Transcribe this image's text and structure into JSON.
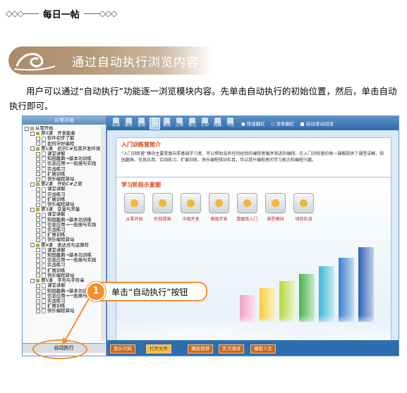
{
  "header": {
    "tip_title": "每日一帖",
    "decor_left": "◇◇◇——",
    "decor_right": "——◇◇◇"
  },
  "section": {
    "title": "通过自动执行浏览内容"
  },
  "paragraph": "用户可以通过“自动执行”功能逐一浏览模块内容。先单击自动执行的初始位置，然后，单击自动执行即可。",
  "screenshot": {
    "panel_title": "从零开始",
    "tree": [
      {
        "level": 0,
        "kind": "root",
        "text": "从零开始"
      },
      {
        "level": 1,
        "kind": "book",
        "text": "第0课　开发能泰"
      },
      {
        "level": 2,
        "kind": "page",
        "text": "软件初步了解"
      },
      {
        "level": 2,
        "kind": "page",
        "text": "如何学好编程"
      },
      {
        "level": 1,
        "kind": "book",
        "text": "第1课　初识C#及其开发环境"
      },
      {
        "level": 2,
        "kind": "page",
        "text": "课堂讲解"
      },
      {
        "level": 2,
        "kind": "page",
        "text": "知园趣典→基本功训练"
      },
      {
        "level": 2,
        "kind": "page",
        "text": "信息应用→一拓展与实践"
      },
      {
        "level": 2,
        "kind": "page",
        "text": "实战练习"
      },
      {
        "level": 2,
        "kind": "page",
        "text": "扩展训练"
      },
      {
        "level": 2,
        "kind": "page",
        "text": "快乐编程驿站"
      },
      {
        "level": 1,
        "kind": "book",
        "text": "第2课　开始C#之旅"
      },
      {
        "level": 2,
        "kind": "page",
        "text": "课堂讲解"
      },
      {
        "level": 2,
        "kind": "page",
        "text": "实战练习"
      },
      {
        "level": 2,
        "kind": "page",
        "text": "扩展训练"
      },
      {
        "level": 2,
        "kind": "page",
        "text": "快乐编程驿站"
      },
      {
        "level": 1,
        "kind": "book",
        "text": "第3课　变量与常量"
      },
      {
        "level": 2,
        "kind": "page",
        "text": "课堂讲解"
      },
      {
        "level": 2,
        "kind": "page",
        "text": "知园趣典→基本功训练"
      },
      {
        "level": 2,
        "kind": "page",
        "text": "信息应用→一拓展与实践"
      },
      {
        "level": 2,
        "kind": "page",
        "text": "实战练习"
      },
      {
        "level": 2,
        "kind": "page",
        "text": "扩展训练"
      },
      {
        "level": 2,
        "kind": "page",
        "text": "快乐编程驿站"
      },
      {
        "level": 1,
        "kind": "book",
        "text": "第4课　表达式与运算符"
      },
      {
        "level": 2,
        "kind": "page",
        "text": "课堂讲解"
      },
      {
        "level": 2,
        "kind": "page",
        "text": "知园趣典→基本功训练"
      },
      {
        "level": 2,
        "kind": "page",
        "text": "信息应用→一拓展与实践"
      },
      {
        "level": 2,
        "kind": "page",
        "text": "实战练习"
      },
      {
        "level": 2,
        "kind": "page",
        "text": "扩展训练"
      },
      {
        "level": 2,
        "kind": "page",
        "text": "快乐编程驿站"
      },
      {
        "level": 1,
        "kind": "book",
        "text": "第5课　字符与字符串"
      },
      {
        "level": 2,
        "kind": "page",
        "text": "课堂讲解"
      },
      {
        "level": 2,
        "kind": "page",
        "text": "知园趣典→基本功训练"
      },
      {
        "level": 2,
        "kind": "page",
        "text": "信息应用→一拓展与实践"
      },
      {
        "level": 2,
        "kind": "page",
        "text": "实战练习"
      },
      {
        "level": 2,
        "kind": "page",
        "text": "扩展训练"
      },
      {
        "level": 2,
        "kind": "page",
        "text": "快乐编程驿站"
      }
    ],
    "auto_button": "自动执行",
    "toolbar": [
      "后退",
      "前进",
      "复制",
      "选择",
      "搜索",
      "心得",
      "笔记",
      "打印",
      "隐藏",
      "书签"
    ],
    "radios": [
      "● 快速翻红",
      "○ 逐条翻红",
      "■ 启动滚动阅读"
    ],
    "intro_title": "入门训练营简介",
    "intro_text": "“入门训练营”模块主要是面向零基础学习者，可以帮助没有任何经验的编程者循序渐进的编程。在入门训练营的每一课都提供了课堂讲解、知园趣典、信息应用、实战练习、扩展训练、快乐编程驿站栏目，可以提升编程者的学习能力和编程兴趣。",
    "flow_title": "学习阶段示意图",
    "steps": [
      "从零开始",
      "阶段提高",
      "中级开发",
      "高级开发",
      "数据库入门",
      "典型模块",
      "项目实战"
    ],
    "bars": [
      {
        "color": "#f2a0c4",
        "level": 0.32
      },
      {
        "color": "#f7cd3a",
        "level": 0.4
      },
      {
        "color": "#b5d93b",
        "level": 0.48
      },
      {
        "color": "#47b34a",
        "level": 0.57
      },
      {
        "color": "#3db8d4",
        "level": 0.66
      },
      {
        "color": "#3b7fd0",
        "level": 0.76
      },
      {
        "color": "#2f5fb5",
        "level": 0.88
      }
    ],
    "bottom_buttons": [
      {
        "text": "显示代码",
        "highlight": false
      },
      {
        "text": "打开文件",
        "highlight": true
      },
      {
        "text": "播放视频",
        "highlight": false
      },
      {
        "text": "实力测试",
        "highlight": false
      },
      {
        "text": "编程人生",
        "highlight": false
      }
    ]
  },
  "callout": {
    "number": "1",
    "text": "单击“自动执行”按钮"
  },
  "colors": {
    "accent": "#f48f2c",
    "banner": "#aa8a69"
  }
}
